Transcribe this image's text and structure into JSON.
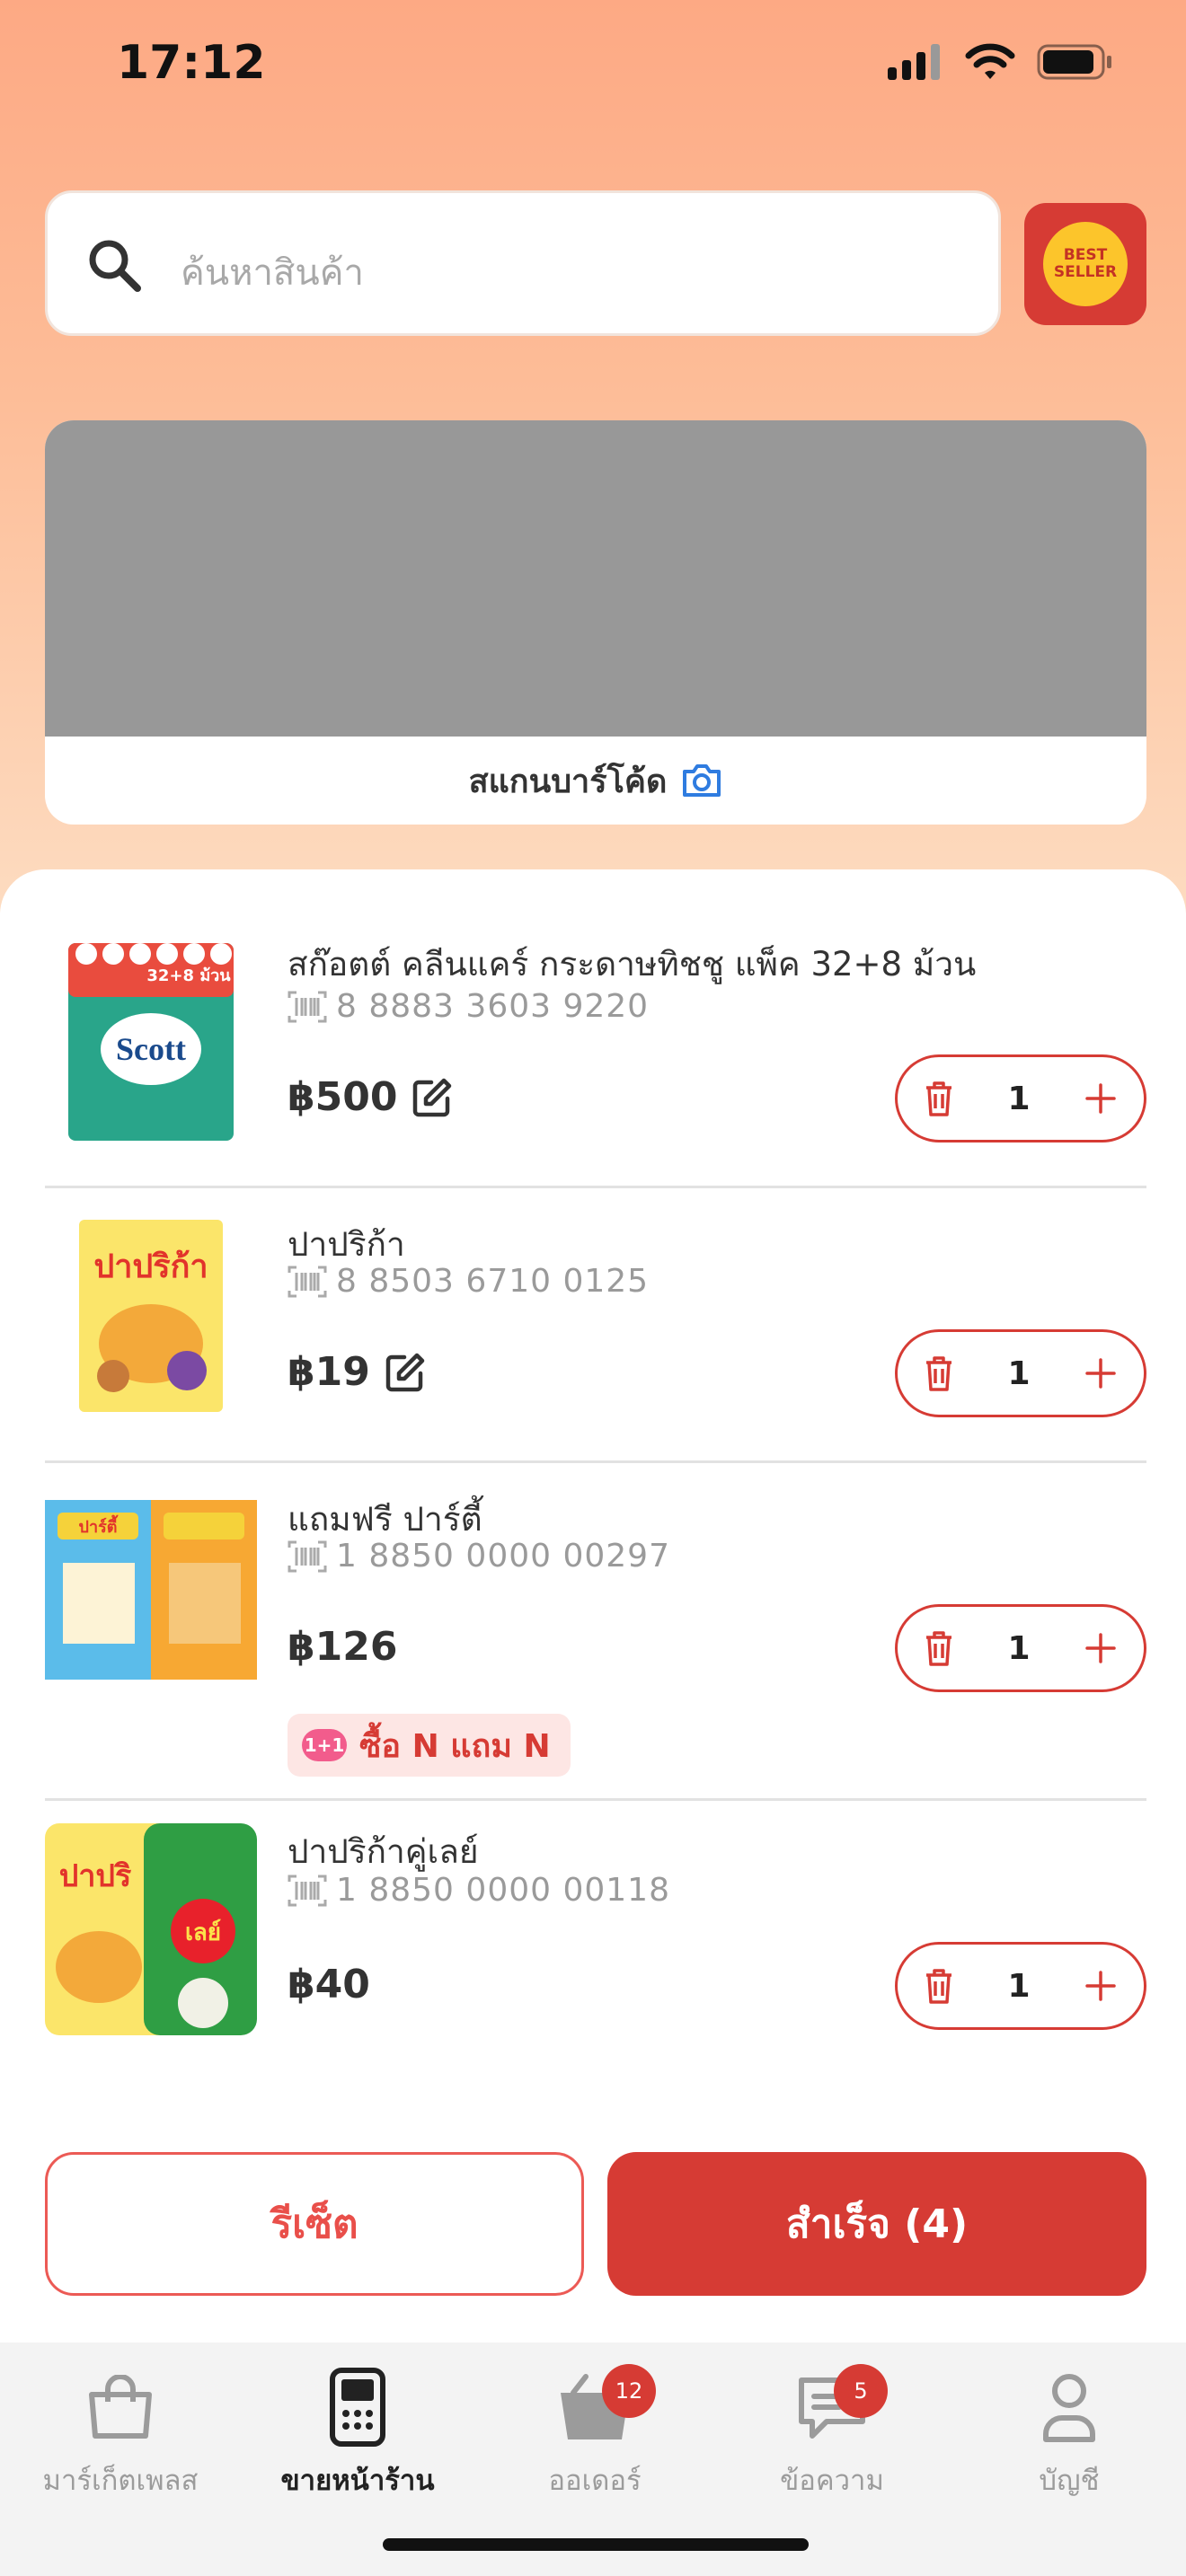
{
  "status_bar": {
    "time": "17:12"
  },
  "search": {
    "placeholder": "ค้นหาสินค้า",
    "best_seller_line1": "BEST",
    "best_seller_line2": "SELLER"
  },
  "scanner": {
    "label": "สแกนบาร์โค้ด"
  },
  "cart": {
    "items": [
      {
        "name": "สก๊อตต์ คลีนแคร์ กระดาษทิชชู แพ็ค 32+8 ม้วน",
        "barcode": "8 8883 3603 9220",
        "price": "฿500",
        "quantity": "1",
        "editable": true,
        "thumb_text": "Scott",
        "thumb_sub": "32+8 ม้วน"
      },
      {
        "name": "ปาปริก้า",
        "barcode": "8 8503 6710 0125",
        "price": "฿19",
        "quantity": "1",
        "editable": true,
        "thumb_text": "ปาปริก้า"
      },
      {
        "name": "แถมฟรี ปาร์ตี้",
        "barcode": "1 8850 0000 00297",
        "price": "฿126",
        "quantity": "1",
        "editable": false,
        "promo": "ซื้อ N แถม N",
        "promo_icon": "1+1",
        "thumb_text": "ปาร์ตี้"
      },
      {
        "name": "ปาปริก้าคู่เลย์",
        "barcode": "1 8850 0000 00118",
        "price": "฿40",
        "quantity": "1",
        "editable": false,
        "thumb_text": "ปาปริ",
        "thumb_text2": "เลย์"
      }
    ]
  },
  "actions": {
    "reset_label": "รีเซ็ต",
    "done_label": "สำเร็จ (4)"
  },
  "tabs": [
    {
      "label": "มาร์เก็ตเพลส",
      "icon": "shopping-bag-icon",
      "active": false
    },
    {
      "label": "ขายหน้าร้าน",
      "icon": "pos-terminal-icon",
      "active": true
    },
    {
      "label": "ออเดอร์",
      "icon": "basket-icon",
      "active": false,
      "badge": "12"
    },
    {
      "label": "ข้อความ",
      "icon": "chat-icon",
      "active": false,
      "badge": "5"
    },
    {
      "label": "บัญชี",
      "icon": "person-icon",
      "active": false
    }
  ],
  "colors": {
    "primary": "#d63b34",
    "gradient_top": "#fda984",
    "gradient_bottom": "#fde0c6"
  }
}
